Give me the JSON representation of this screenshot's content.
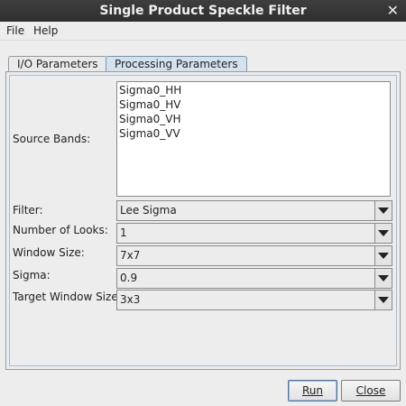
{
  "window": {
    "title": "Single Product Speckle Filter",
    "close_glyph": "✕"
  },
  "menu": {
    "items": [
      "File",
      "Help"
    ]
  },
  "tabs": [
    {
      "label": "I/O Parameters",
      "active": false
    },
    {
      "label": "Processing Parameters",
      "active": true
    }
  ],
  "form": {
    "source_bands_label": "Source Bands:",
    "source_bands": [
      "Sigma0_HH",
      "Sigma0_HV",
      "Sigma0_VH",
      "Sigma0_VV"
    ],
    "filter_label": "Filter:",
    "filter_value": "Lee Sigma",
    "looks_label": "Number of Looks:",
    "looks_value": "1",
    "window_size_label": "Window Size:",
    "window_size_value": "7x7",
    "sigma_label": "Sigma:",
    "sigma_value": "0.9",
    "target_window_label": "Target Window Size:",
    "target_window_value": "3x3"
  },
  "buttons": {
    "run": "Run",
    "close": "Close"
  }
}
